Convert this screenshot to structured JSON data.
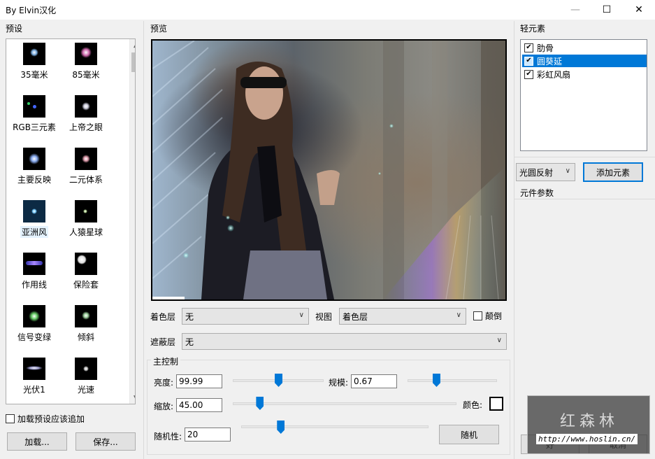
{
  "window": {
    "title": "By Elvin汉化",
    "min": "—",
    "max": "☐",
    "close": "✕"
  },
  "presets": {
    "label": "预设",
    "items": [
      {
        "label": "35毫米"
      },
      {
        "label": "85毫米"
      },
      {
        "label": "RGB三元素"
      },
      {
        "label": "上帝之眼"
      },
      {
        "label": "主要反映"
      },
      {
        "label": "二元体系"
      },
      {
        "label": "亚洲风"
      },
      {
        "label": "人猿星球"
      },
      {
        "label": "作用线"
      },
      {
        "label": "保险套"
      },
      {
        "label": "信号变绿"
      },
      {
        "label": "倾斜"
      },
      {
        "label": "光伏1"
      },
      {
        "label": "光速"
      }
    ],
    "append_checkbox": "加载预设应该追加",
    "load_button": "加载...",
    "save_button": "保存..."
  },
  "preview": {
    "label": "预览",
    "color_layer_label": "着色层",
    "color_layer_value": "无",
    "view_label": "视图",
    "view_value": "着色层",
    "invert_label": "颠倒",
    "mask_layer_label": "遮蔽层",
    "mask_layer_value": "无"
  },
  "main_controls": {
    "label": "主控制",
    "brightness_label": "亮度:",
    "brightness_value": "99.99",
    "scale_label": "规模:",
    "scale_value": "0.67",
    "zoom_label": "缩放:",
    "zoom_value": "45.00",
    "color_label": "颜色:",
    "random_label": "随机性:",
    "random_value": "20",
    "random_button": "随机",
    "color_swatch": "#ffffff",
    "brightness_slider": 0.5,
    "scale_slider": 0.32,
    "zoom_slider": 0.12,
    "random_slider": 0.21
  },
  "elements": {
    "label": "轻元素",
    "items": [
      {
        "label": "肋骨",
        "checked": true
      },
      {
        "label": "圆葵延",
        "checked": true,
        "selected": true
      },
      {
        "label": "彩虹风扇",
        "checked": true
      }
    ],
    "type_value": "光圆反射",
    "add_button": "添加元素",
    "params_label": "元件参数",
    "ok_button": "好",
    "cancel_button": "取消"
  },
  "watermark": {
    "title": "红森林",
    "url": "http://www.hoslin.cn/"
  }
}
